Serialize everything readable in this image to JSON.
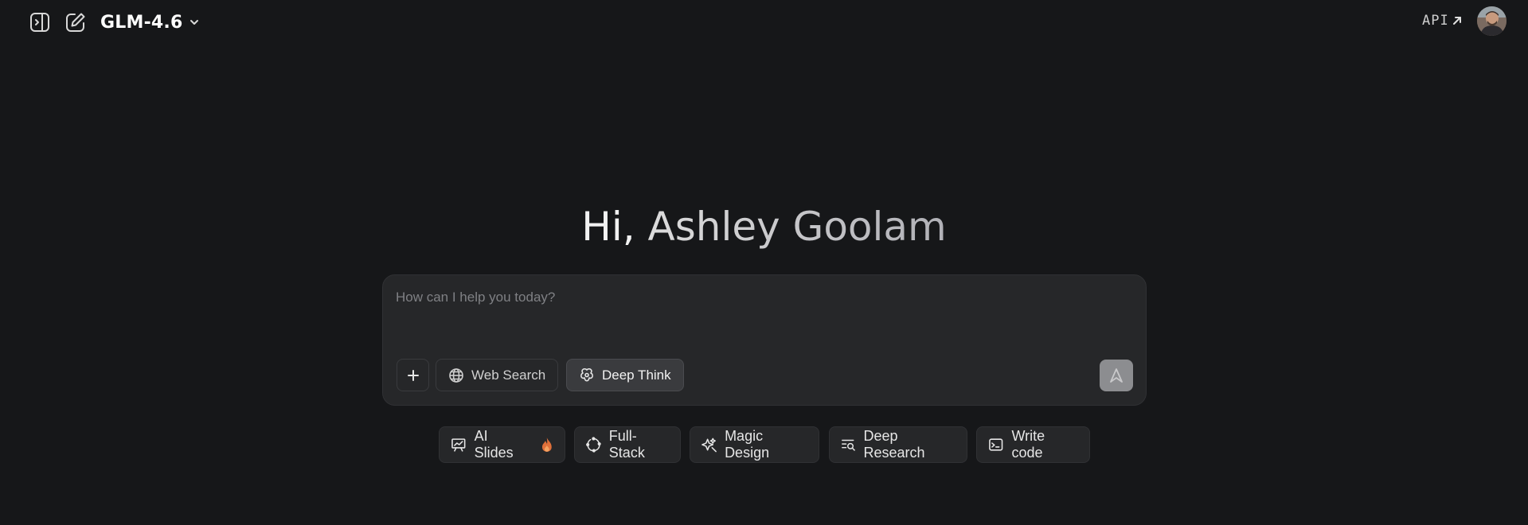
{
  "header": {
    "model_name": "GLM-4.6",
    "api_label": "API",
    "icons": {
      "sidebar_toggle": "sidebar-toggle-icon",
      "new_chat": "new-chat-icon",
      "model_dropdown": "chevron-down-icon",
      "api_external": "arrow-up-right-icon"
    }
  },
  "greeting": {
    "hi": "Hi,",
    "name": "Ashley Goolam"
  },
  "composer": {
    "placeholder": "How can I help you today?",
    "value": "",
    "tools": [
      {
        "label": "Web Search",
        "icon": "globe-icon",
        "active": false
      },
      {
        "label": "Deep Think",
        "icon": "deep-think-icon",
        "active": true
      }
    ],
    "add_icon": "plus-icon",
    "send_icon": "send-icon"
  },
  "chips": [
    {
      "label": "AI Slides",
      "icon": "slides-icon",
      "badge_icon": "fire-icon"
    },
    {
      "label": "Full-Stack",
      "icon": "full-stack-icon"
    },
    {
      "label": "Magic Design",
      "icon": "magic-design-icon"
    },
    {
      "label": "Deep Research",
      "icon": "deep-research-icon"
    },
    {
      "label": "Write code",
      "icon": "terminal-icon"
    }
  ],
  "colors": {
    "background": "#161719",
    "surface": "#262729",
    "border": "#303134",
    "text": "#e6e6e6",
    "placeholder": "#7f8084",
    "send_button": "#8c8d90",
    "fire": "#e0703a"
  }
}
